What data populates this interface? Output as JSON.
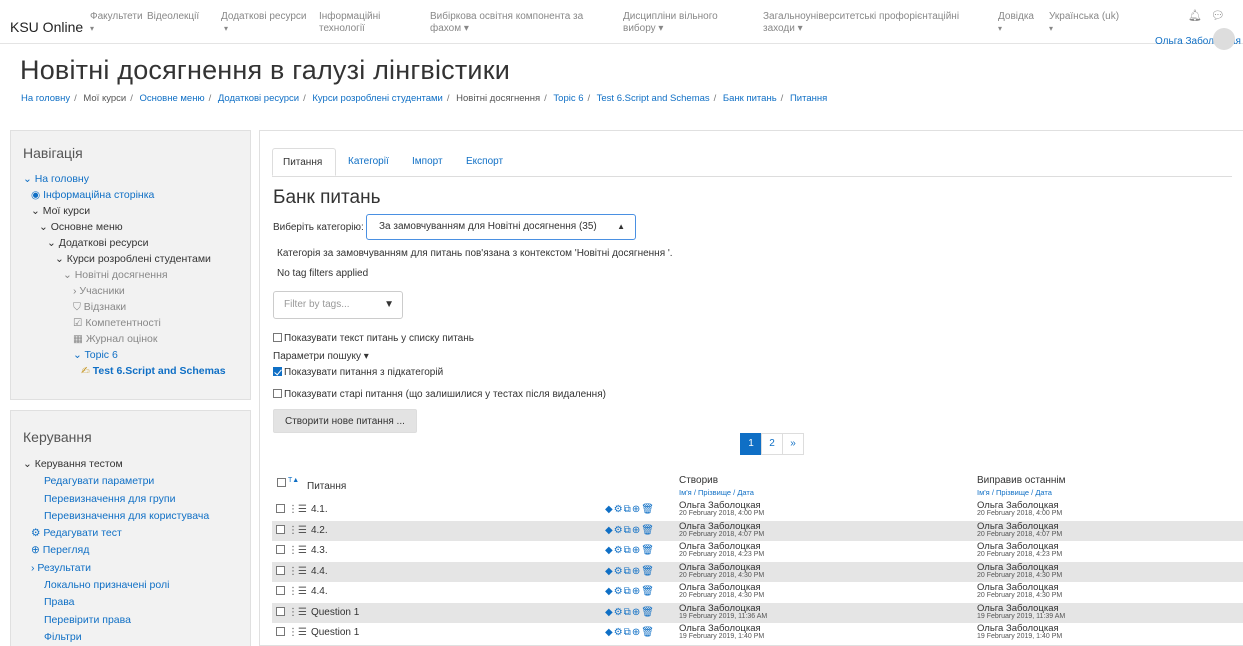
{
  "navbar": {
    "brand": "KSU Online",
    "items": [
      {
        "label": "Факультети",
        "caret": "▾"
      },
      {
        "label": "Відеолекції"
      },
      {
        "label": "Додаткові ресурси",
        "caret": "▾"
      },
      {
        "label": "Інформаційні технології"
      },
      {
        "label": "Вибіркова освітня компонента за фахом ▾"
      },
      {
        "label": "Дисципліни вільного вибору ▾"
      },
      {
        "label": "Загальноуніверситетські профорієнтаційні заходи ▾"
      },
      {
        "label": "Довідка",
        "caret": "▾"
      },
      {
        "label": "Українська (uk)",
        "caret": "▾"
      }
    ],
    "bell_icon": "bell-icon",
    "chat_icon": "chat-icon",
    "user_name": "Ольга Заболоцкая"
  },
  "header": {
    "title": "Новітні досягнення в галузі лінгвістики",
    "breadcrumb": [
      "На головну",
      "Мої курси",
      "Основне меню",
      "Додаткові ресурси",
      "Курси розроблені студентами",
      "Новітні досягнення",
      "Topic 6",
      "Test 6.Script and Schemas",
      "Банк питань",
      "Питання"
    ]
  },
  "nav_block": {
    "title": "Навігація",
    "items": [
      "На головну",
      "Інформаційна сторінка",
      "Мої курси",
      "Основне меню",
      "Додаткові ресурси",
      "Курси розроблені студентами",
      "Новітні досягнення",
      "Учасники",
      "Відзнаки",
      "Компетентності",
      "Журнал оцінок",
      "Topic 6",
      "Test 6.Script and Schemas"
    ]
  },
  "admin_block": {
    "title": "Керування",
    "items": [
      "Керування тестом",
      "Редагувати параметри",
      "Перевизначення для групи",
      "Перевизначення для користувача",
      "Редагувати тест",
      "Перегляд",
      "Результати",
      "Локально призначені ролі",
      "Права",
      "Перевірити права",
      "Фільтри"
    ]
  },
  "tabs": [
    "Питання",
    "Категорії",
    "Імпорт",
    "Експорт"
  ],
  "bank": {
    "title": "Банк питань",
    "category_label": "Виберіть категорію:",
    "category_value": "За замовчуванням для Новітні досягнення (35)",
    "category_desc": "Категорія за замовчуванням для питань пов'язана з контекстом 'Новітні досягнення '.",
    "no_filters": "No tag filters applied",
    "filter_placeholder": "Filter by tags...",
    "show_text": "Показувати текст питань у списку питань",
    "search_params": "Параметри пошуку ▾",
    "show_sub": "Показувати питання з підкатегорій",
    "show_old": "Показувати старі питання (що залишилися у тестах після видалення)",
    "create_btn": "Створити нове питання ..."
  },
  "pager": {
    "current": "1",
    "next": "2",
    "arrow": "»"
  },
  "table": {
    "col_question": "Питання",
    "col_created": "Створив",
    "col_modified": "Виправив останнім",
    "sub_header": "Ім'я / Прізвище / Дата",
    "rows": [
      {
        "name": "4.1.",
        "created_by": "Ольга Заболоцкая",
        "created": "20 February 2018, 4:00 PM",
        "modified_by": "Ольга Заболоцкая",
        "modified": "20 February 2018, 4:00 PM"
      },
      {
        "name": "4.2.",
        "created_by": "Ольга Заболоцкая",
        "created": "20 February 2018, 4:07 PM",
        "modified_by": "Ольга Заболоцкая",
        "modified": "20 February 2018, 4:07 PM"
      },
      {
        "name": "4.3.",
        "created_by": "Ольга Заболоцкая",
        "created": "20 February 2018, 4:23 PM",
        "modified_by": "Ольга Заболоцкая",
        "modified": "20 February 2018, 4:23 PM"
      },
      {
        "name": "4.4.",
        "created_by": "Ольга Заболоцкая",
        "created": "20 February 2018, 4:30 PM",
        "modified_by": "Ольга Заболоцкая",
        "modified": "20 February 2018, 4:30 PM"
      },
      {
        "name": "4.4.",
        "created_by": "Ольга Заболоцкая",
        "created": "20 February 2018, 4:30 PM",
        "modified_by": "Ольга Заболоцкая",
        "modified": "20 February 2018, 4:30 PM"
      },
      {
        "name": "Question 1",
        "created_by": "Ольга Заболоцкая",
        "created": "19 February 2019, 11:36 AM",
        "modified_by": "Ольга Заболоцкая",
        "modified": "19 February 2019, 11:39 AM"
      },
      {
        "name": "Question 1",
        "created_by": "Ольга Заболоцкая",
        "created": "19 February 2019, 1:40 PM",
        "modified_by": "Ольга Заболоцкая",
        "modified": "19 February 2019, 1:40 PM"
      }
    ]
  }
}
